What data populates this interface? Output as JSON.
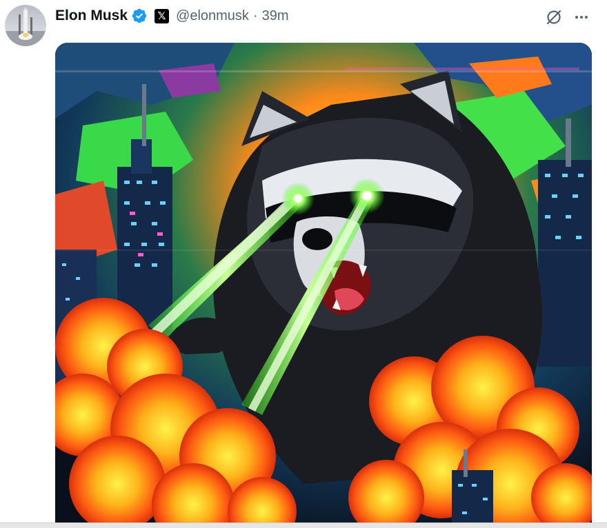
{
  "author": {
    "name": "Elon Musk",
    "handle": "@elonmusk",
    "separator": "·",
    "time": "39m",
    "verified": true,
    "affiliation_badge": "𝕏"
  },
  "actions": {
    "grok_icon": "grok-icon",
    "more_icon": "more-icon"
  },
  "media": {
    "alt": "Pixel-art raccoon with green laser eyes destroying a neon city with explosions"
  },
  "colors": {
    "verified_blue": "#1d9bf0",
    "text_primary": "#0f1419",
    "text_secondary": "#536471",
    "laser_green": "#39ff14"
  }
}
